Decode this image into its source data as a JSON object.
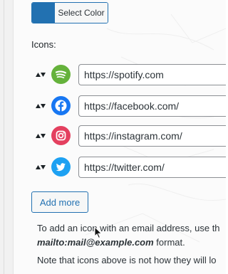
{
  "color_picker": {
    "label": "Select Color",
    "swatch_color": "#2271b1"
  },
  "icons_section": {
    "label": "Icons:",
    "items": [
      {
        "icon": "spotify-icon",
        "color": "#65b23b",
        "url": "https://spotify.com"
      },
      {
        "icon": "facebook-icon",
        "color": "#1877f2",
        "url": "https://facebook.com/"
      },
      {
        "icon": "instagram-icon",
        "color": "#e4405f",
        "url": "https://instagram.com/"
      },
      {
        "icon": "twitter-icon",
        "color": "#1da1f2",
        "url": "https://twitter.com/"
      }
    ]
  },
  "add_more": {
    "label": "Add more"
  },
  "help": {
    "line1_a": "To add an icon with an email address, use th",
    "line2_em": "mailto:mail@example.com",
    "line2_b": " format.",
    "line3": "Note that icons above is not how they will lo"
  }
}
